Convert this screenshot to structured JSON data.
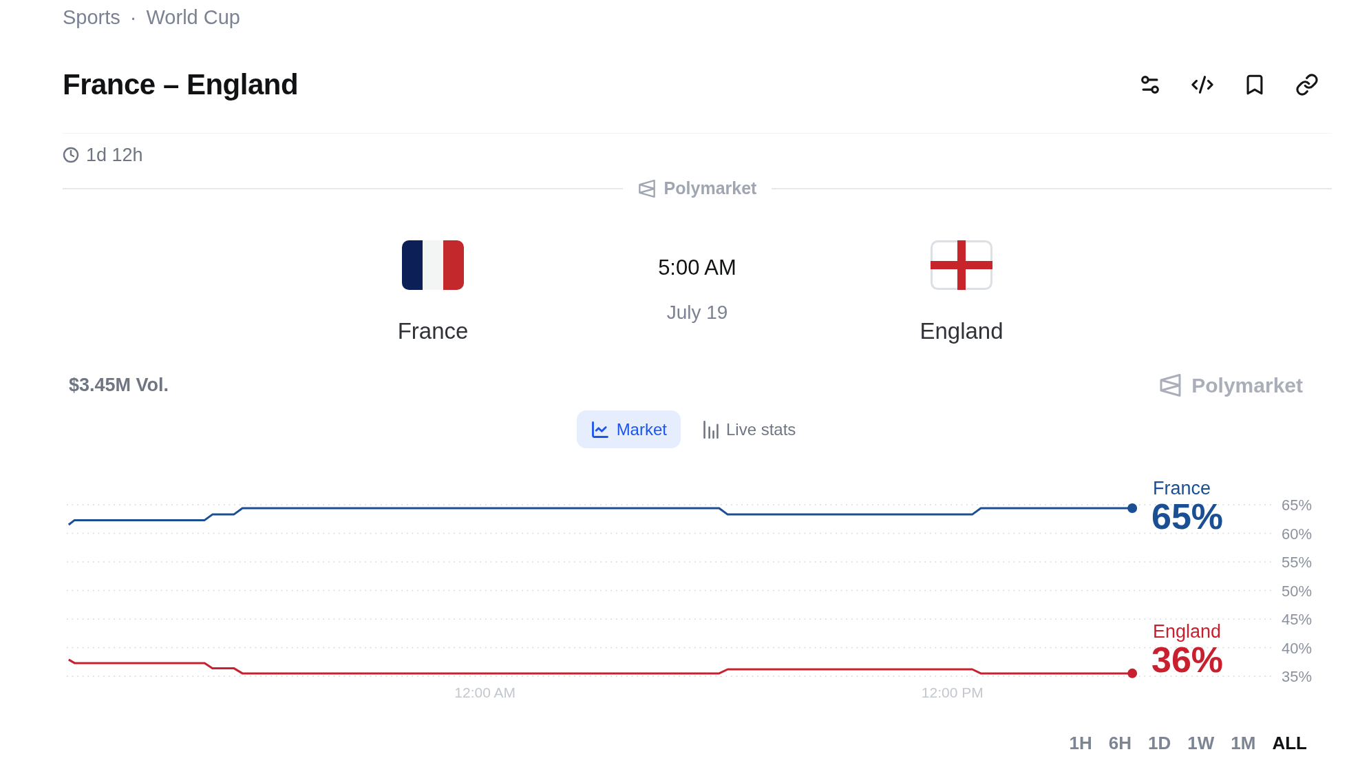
{
  "breadcrumb": {
    "items": [
      "Sports",
      "World Cup"
    ],
    "separator": "·"
  },
  "title": "France – England",
  "countdown": "1d 12h",
  "source_label": "Polymarket",
  "teams": [
    {
      "name": "France"
    },
    {
      "name": "England"
    }
  ],
  "kickoff": {
    "time": "5:00 AM",
    "date": "July 19"
  },
  "volume": "$3.45M Vol.",
  "brand": "Polymarket",
  "tabs": [
    {
      "label": "Market",
      "selected": true
    },
    {
      "label": "Live stats",
      "selected": false
    }
  ],
  "chart": {
    "chart_data": {
      "type": "line",
      "x": [
        -10.69,
        -10.54,
        -7.2,
        -7.0,
        -6.45,
        -6.23,
        6.01,
        6.23,
        12.51,
        12.73,
        16.62
      ],
      "series": [
        {
          "name": "France",
          "color": "#1b4f93",
          "values": [
            61.5,
            62.3,
            62.3,
            63.3,
            63.3,
            64.4,
            64.4,
            63.3,
            63.3,
            64.4,
            64.4
          ]
        },
        {
          "name": "England",
          "color": "#c8202f",
          "values": [
            37.9,
            37.3,
            37.3,
            36.4,
            36.4,
            35.5,
            35.5,
            36.2,
            36.2,
            35.5,
            35.5
          ]
        }
      ],
      "xlim": [
        -10.74,
        20.24
      ],
      "ylim": [
        35,
        65
      ],
      "xticks": [
        {
          "value": 0,
          "label": "12:00 AM"
        },
        {
          "value": 12,
          "label": "12:00 PM"
        }
      ],
      "yticks": [
        {
          "value": 65,
          "label": "65%"
        },
        {
          "value": 60,
          "label": "60%"
        },
        {
          "value": 55,
          "label": "55%"
        },
        {
          "value": 50,
          "label": "50%"
        },
        {
          "value": 45,
          "label": "45%"
        },
        {
          "value": 40,
          "label": "40%"
        },
        {
          "value": 35,
          "label": "35%"
        }
      ],
      "grid": true
    },
    "current_values": [
      "65%",
      "36%"
    ]
  },
  "ranges": [
    {
      "label": "1H",
      "selected": false
    },
    {
      "label": "6H",
      "selected": false
    },
    {
      "label": "1D",
      "selected": false
    },
    {
      "label": "1W",
      "selected": false
    },
    {
      "label": "1M",
      "selected": false
    },
    {
      "label": "ALL",
      "selected": true
    }
  ]
}
